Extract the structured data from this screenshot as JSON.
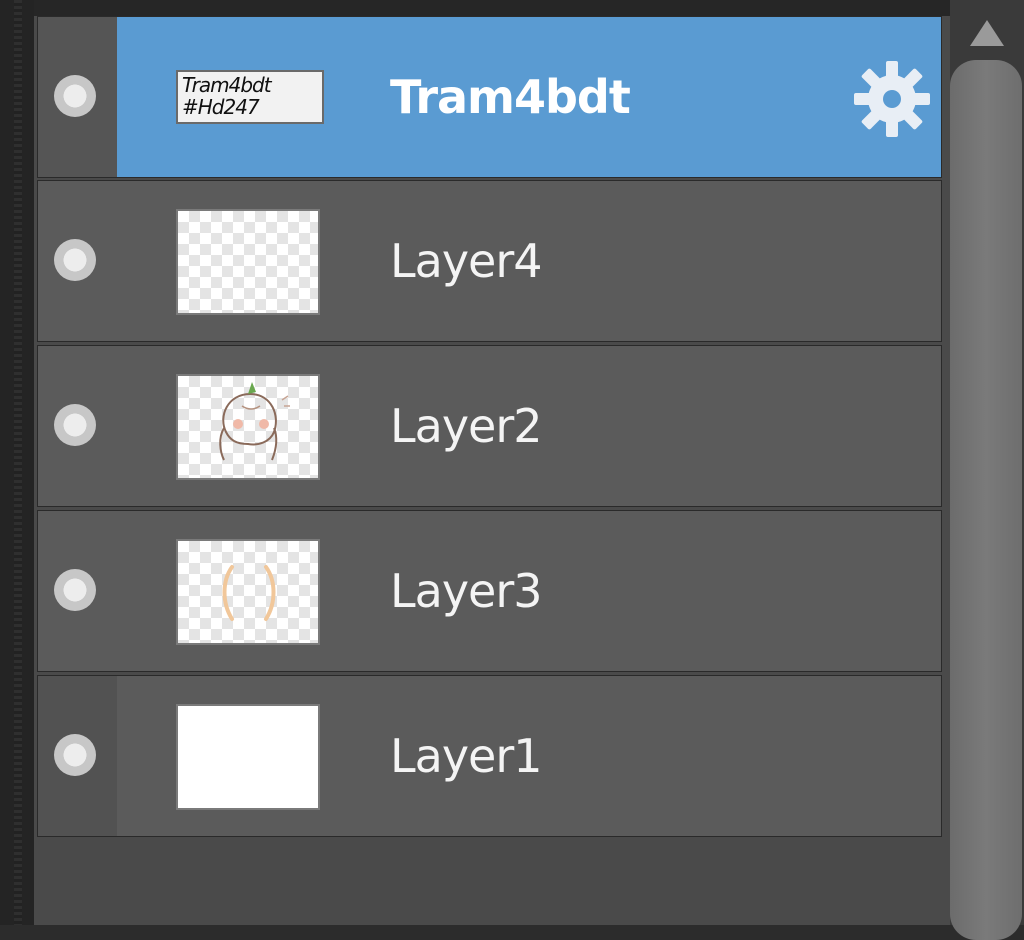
{
  "layers_panel": {
    "layers": [
      {
        "name": "Tram4bdt",
        "selected": true,
        "thumbnail": "text",
        "thumb_text": [
          "Tram4bdt",
          "#Hd247"
        ]
      },
      {
        "name": "Layer4",
        "selected": false,
        "thumbnail": "transparent"
      },
      {
        "name": "Layer2",
        "selected": false,
        "thumbnail": "character-sketch"
      },
      {
        "name": "Layer3",
        "selected": false,
        "thumbnail": "orange-strokes"
      },
      {
        "name": "Layer1",
        "selected": false,
        "thumbnail": "white"
      }
    ],
    "icons": {
      "visibility": "visibility-dot-icon",
      "settings": "gear-icon",
      "scroll_up": "triangle-up-icon"
    },
    "colors": {
      "selected_row": "#5a9bd2",
      "row": "#5b5b5b",
      "panel": "#4a4a4a"
    }
  }
}
